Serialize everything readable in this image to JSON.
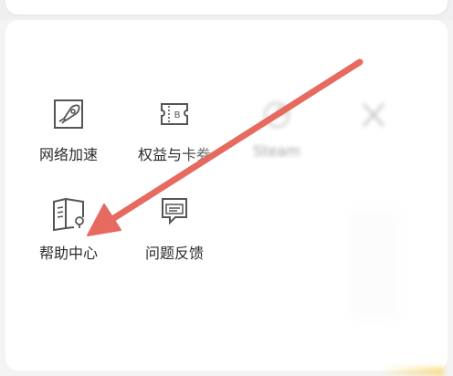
{
  "section": {
    "title": ""
  },
  "services": [
    {
      "label": "网络加速",
      "icon": "rocket-icon"
    },
    {
      "label": "权益与卡券",
      "icon": "ticket-icon"
    },
    {
      "label": "Steam",
      "icon": "steam-icon"
    },
    {
      "label": "",
      "icon": "tool-icon"
    },
    {
      "label": "帮助中心",
      "icon": "help-book-icon"
    },
    {
      "label": "问题反馈",
      "icon": "feedback-chat-icon"
    }
  ],
  "annotation": {
    "arrow_color": "#e56357",
    "arrow_target": "帮助中心"
  },
  "colors": {
    "icon_stroke": "#555555",
    "label_text": "#2b2b2b"
  }
}
